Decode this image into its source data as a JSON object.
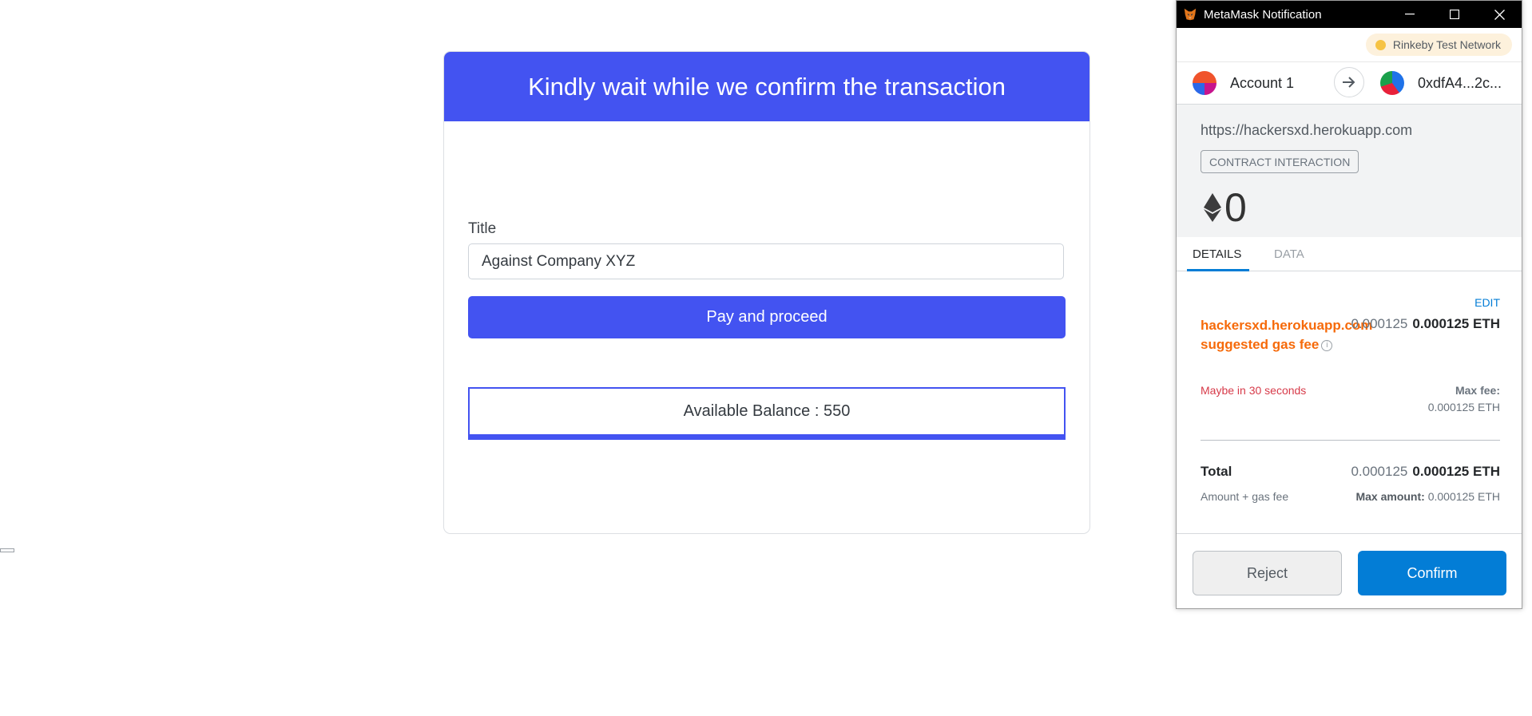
{
  "page": {
    "header": "Kindly wait while we confirm the transaction",
    "title_label": "Title",
    "title_value": "Against Company XYZ",
    "pay_button": "Pay and proceed",
    "balance_text": "Available Balance : 550"
  },
  "metamask": {
    "window_title": "MetaMask Notification",
    "network": "Rinkeby Test Network",
    "account_name": "Account 1",
    "recipient": "0xdfA4...2c...",
    "origin": "https://hackersxd.herokuapp.com",
    "badge": "CONTRACT INTERACTION",
    "amount": "0",
    "tabs": {
      "details": "DETAILS",
      "data": "DATA"
    },
    "edit": "EDIT",
    "gas_label": "hackersxd.herokuapp.com suggested gas fee",
    "gas_secondary": "0.000125",
    "gas_primary": "0.000125 ETH",
    "maybe_text": "Maybe in 30 seconds",
    "max_fee_label": "Max fee:",
    "max_fee_value": "0.000125 ETH",
    "total_label": "Total",
    "total_secondary": "0.000125",
    "total_primary": "0.000125 ETH",
    "amount_gas_label": "Amount + gas fee",
    "max_amount_label": "Max amount:",
    "max_amount_value": "0.000125 ETH",
    "reject": "Reject",
    "confirm": "Confirm"
  },
  "colors": {
    "brand_blue": "#4353f1",
    "metamask_blue": "#037dd6",
    "gas_orange": "#f66a0a",
    "warning_red": "#d73a49",
    "network_dot": "#f6c343"
  },
  "icons": [
    "metamask-fox-icon",
    "minimize-icon",
    "maximize-icon",
    "close-icon",
    "arrow-right-icon",
    "ethereum-icon",
    "info-icon"
  ]
}
